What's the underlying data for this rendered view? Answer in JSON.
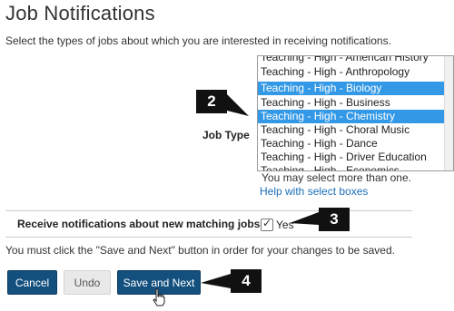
{
  "page": {
    "title": "Job Notifications",
    "intro": "Select the types of jobs about which you are interested in receiving notifications."
  },
  "job_type": {
    "label": "Job Type",
    "options": [
      {
        "label": "Teaching - High - American History",
        "selected": false
      },
      {
        "label": "Teaching - High - Anthropology",
        "selected": false
      },
      {
        "label": "Teaching - High - Biology",
        "selected": true
      },
      {
        "label": "Teaching - High - Business",
        "selected": false
      },
      {
        "label": "Teaching - High - Chemistry",
        "selected": true
      },
      {
        "label": "Teaching - High - Choral Music",
        "selected": false
      },
      {
        "label": "Teaching - High - Dance",
        "selected": false
      },
      {
        "label": "Teaching - High - Driver Education",
        "selected": false
      },
      {
        "label": "Teaching - High - Economics",
        "selected": false
      }
    ],
    "hint": "You may select more than one.",
    "help_link": "Help with select boxes"
  },
  "notifications": {
    "label": "Receive notifications about new matching jobs?",
    "checked": true,
    "yes_label": "Yes"
  },
  "notice": "You must click the \"Save and Next\" button in order for your changes to be saved.",
  "buttons": {
    "cancel": "Cancel",
    "undo": "Undo",
    "save_next": "Save and Next"
  },
  "callouts": {
    "c2": "2",
    "c3": "3",
    "c4": "4"
  },
  "colors": {
    "selected_option": "#3399e6",
    "primary_button": "#14507e",
    "link": "#1a6fb8",
    "callout": "#111111"
  }
}
